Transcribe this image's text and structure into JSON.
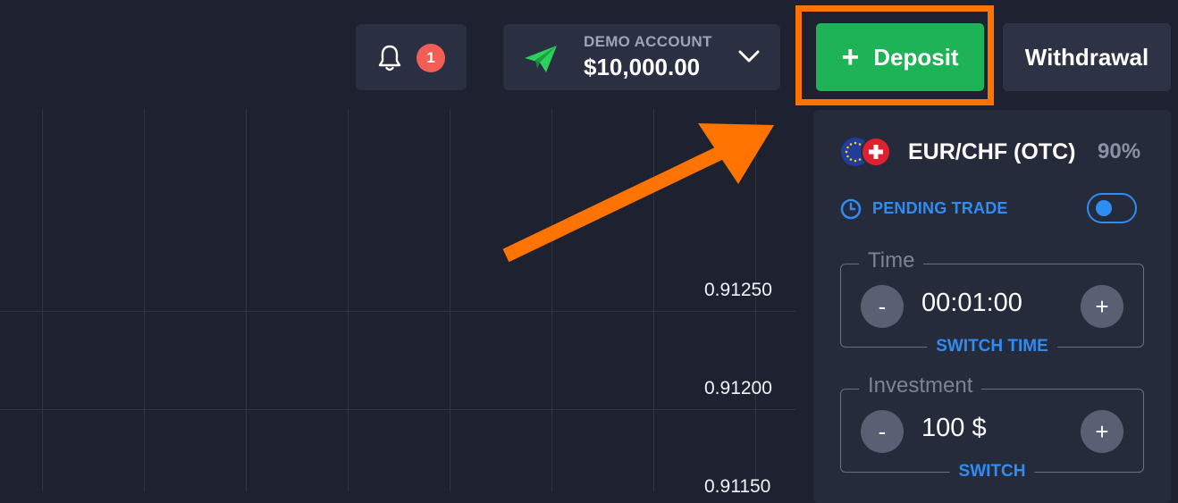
{
  "header": {
    "notifications": {
      "count": "1"
    },
    "account": {
      "type_label": "DEMO ACCOUNT",
      "balance": "$10,000.00"
    },
    "deposit_label": "Deposit",
    "withdrawal_label": "Withdrawal"
  },
  "chart": {
    "price_labels": [
      "0.91250",
      "0.91200",
      "0.91150"
    ]
  },
  "trade_panel": {
    "asset": {
      "name": "EUR/CHF (OTC)",
      "payout": "90%"
    },
    "pending_trade_label": "PENDING TRADE",
    "time": {
      "legend": "Time",
      "value": "00:01:00",
      "switch_label": "SWITCH TIME",
      "minus": "-",
      "plus": "+"
    },
    "investment": {
      "legend": "Investment",
      "value": "100 $",
      "switch_label": "SWITCH",
      "minus": "-",
      "plus": "+"
    }
  },
  "colors": {
    "background": "#1e2130",
    "deposit_green": "#1db356",
    "highlight_orange": "#ff7300",
    "accent_blue": "#2f8cf3",
    "badge_red": "#f25e55"
  },
  "icons": {
    "notifications": "bell-icon",
    "account": "paper-plane-icon",
    "dropdown": "chevron-down-icon",
    "deposit": "plus-icon",
    "pending": "clock-icon",
    "asset": "eu-ch-flags-icon"
  }
}
